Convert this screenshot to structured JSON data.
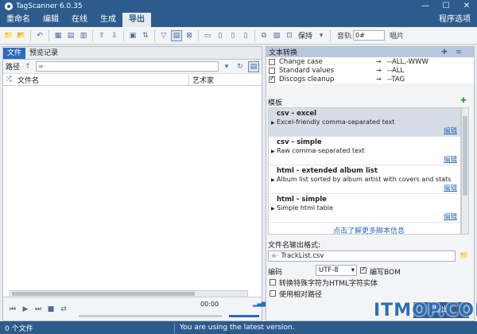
{
  "window": {
    "title": "TagScanner 6.0.35",
    "minimize": "—",
    "maximize": "☐",
    "close": "✕"
  },
  "menu": {
    "items": [
      "重命名",
      "编辑",
      "在线",
      "生成",
      "导出"
    ],
    "active": 4,
    "right": "程序选项"
  },
  "toolbar": {
    "keep_label": "保持",
    "track_label": "音轨",
    "track_value": "0#",
    "cover_label": "唱片"
  },
  "left": {
    "tabs": [
      "文件",
      "预览记录"
    ],
    "path_label": "路径",
    "path_placeholder": "≡·",
    "columns": [
      "文件名",
      "艺术家"
    ],
    "time": "00:00"
  },
  "text_conversion": {
    "title": "文本转换",
    "rows": [
      {
        "checked": false,
        "name": "Change case",
        "arrow": "→",
        "value": "--ALL,-WWW"
      },
      {
        "checked": false,
        "name": "Standard values",
        "arrow": "→",
        "value": "--ALL"
      },
      {
        "checked": true,
        "name": "Discogs cleanup",
        "arrow": "→",
        "value": "--TAG"
      }
    ]
  },
  "templates": {
    "title": "模板",
    "items": [
      {
        "name": "csv - excel",
        "desc": "Excel-friendly comma-separated text",
        "edit": "编辑"
      },
      {
        "name": "csv - simple",
        "desc": "Raw comma-separated text",
        "edit": "编辑"
      },
      {
        "name": "html - extended album list",
        "desc": "Album list sorted by album artist with covers and stats",
        "edit": "编辑"
      },
      {
        "name": "html - simple",
        "desc": "Simple html table",
        "edit": "编辑"
      }
    ],
    "more_link": "点击了解更多脚本信息"
  },
  "output": {
    "format_label": "文件名输出格式:",
    "filename": "TrackList.csv",
    "encoding_label": "编码",
    "encoding_value": "UTF-8",
    "bom_label": "编写BOM",
    "bom_checked": true,
    "opt1": "转换特殊字符为HTML字符实体",
    "opt2": "使用相对路径",
    "export_button": "导出"
  },
  "status": {
    "files": "0 个文件",
    "message": "You are using the latest version."
  },
  "watermark": "ITMOP.COM",
  "colors": {
    "accent": "#2d5b8c",
    "link": "#2d6cb8"
  }
}
